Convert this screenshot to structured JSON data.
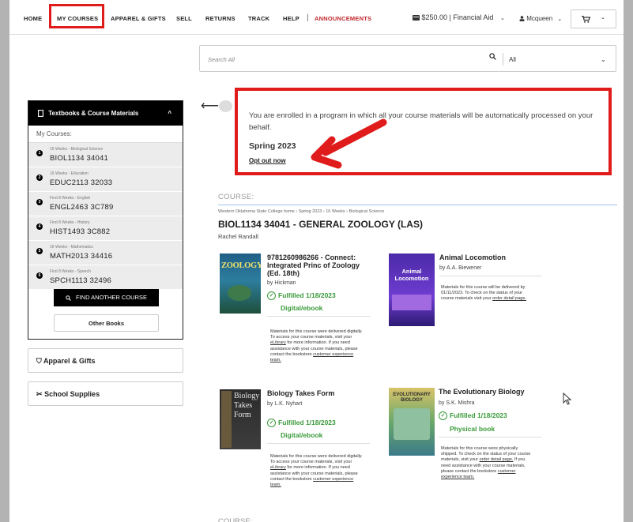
{
  "nav": {
    "items": [
      "HOME",
      "MY COURSES",
      "APPAREL & GIFTS",
      "SELL",
      "RETURNS",
      "TRACK",
      "HELP"
    ],
    "separator": "|",
    "announcements": "ANNOUNCEMENTS",
    "financial_aid": "$250.00 | Financial Aid",
    "user": "Mcqueen"
  },
  "search": {
    "placeholder": "Search All",
    "scope": "All"
  },
  "sidebar": {
    "header": "Textbooks & Course Materials",
    "subheader": "My Courses:",
    "courses": [
      {
        "num": "1",
        "meta": "16 Weeks - Biological Science",
        "code": "BIOL1134 34041"
      },
      {
        "num": "2",
        "meta": "16 Weeks - Education",
        "code": "EDUC2113 32033"
      },
      {
        "num": "3",
        "meta": "First 8 Weeks - English",
        "code": "ENGL2463 3C789"
      },
      {
        "num": "4",
        "meta": "First 8 Weeks - History",
        "code": "HIST1493 3C882"
      },
      {
        "num": "5",
        "meta": "16 Weeks - Mathematics",
        "code": "MATH2013 34416"
      },
      {
        "num": "6",
        "meta": "First 8 Weeks - Speech",
        "code": "SPCH1113 32496"
      }
    ],
    "find_button": "FIND ANOTHER COURSE",
    "other_button": "Other Books",
    "apparel": "Apparel & Gifts",
    "supplies": "School Supplies"
  },
  "notice": {
    "text": "You are enrolled in a program in which all your course materials will be automatically processed on your behalf.",
    "term": "Spring 2023",
    "opt_out": "Opt out now"
  },
  "course": {
    "heading": "COURSE:",
    "breadcrumb": "Western Oklahoma State College home › Spring 2023 › 16 Weeks › Biological Science",
    "title": "BIOL1134 34041 - GENERAL ZOOLOGY (LAS)",
    "instructor": "Rachel Randall"
  },
  "books": [
    {
      "title_lines": [
        "9781260986266 - Connect:",
        "Integrated Princ of Zoology",
        "(Ed. 18th)"
      ],
      "author": "by Hickman",
      "status": "Fulfilled 1/18/2023",
      "type": "Digital/ebook",
      "cover_text": "ZOOLOGY",
      "note_pre": "Materials for this course were delivered digitally. To access your course materials, visit your ",
      "note_link1": "eLibrary",
      "note_mid": " for more information. If you need assistance with your course materials, please contact the bookstore ",
      "note_link2": "customer experience team.",
      "note_post": ""
    },
    {
      "title_lines": [
        "Animal Locomotion"
      ],
      "author": "by A.A. Biewener",
      "status": "",
      "type": "",
      "cover_text": "Animal Locomotion",
      "note_pre": "Materials for this course will be delivered by 01/11/2023. To check on the status of your course materials visit your ",
      "note_link1": "order detail page.",
      "note_mid": "",
      "note_link2": "",
      "note_post": ""
    },
    {
      "title_lines": [
        "Biology Takes Form"
      ],
      "author": "by L.K. Nyhart",
      "status": "Fulfilled 1/18/2023",
      "type": "Digital/ebook",
      "cover_text": "Biology Takes Form",
      "note_pre": "Materials for this course were delivered digitally. To access your course materials, visit your ",
      "note_link1": "eLibrary",
      "note_mid": " for more information. If you need assistance with your course materials, please contact the bookstore ",
      "note_link2": "customer experience team.",
      "note_post": ""
    },
    {
      "title_lines": [
        "The Evolutionary Biology"
      ],
      "author": "by S.K. Mishra",
      "status": "Fulfilled 1/18/2023",
      "type": "Physical book",
      "cover_text": "EVOLUTIONARY BIOLOGY",
      "note_pre": "Materials for this course were physically shipped. To check on the status of your course materials, visit your ",
      "note_link1": "order detail page.",
      "note_mid": " If you need assistance with your course materials, please contact the bookstore ",
      "note_link2": "customer experience team.",
      "note_post": ""
    }
  ],
  "colors": {
    "accent_red": "#e01b1b",
    "success_green": "#3a9a3a",
    "announcement_red": "#c0272d"
  }
}
